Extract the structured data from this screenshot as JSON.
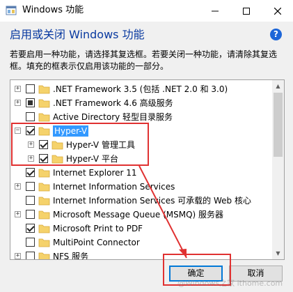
{
  "window": {
    "title": "Windows 功能",
    "minimize_glyph": "—",
    "maximize_glyph": "☐",
    "close_glyph": "✕"
  },
  "heading": "启用或关闭 Windows 功能",
  "help_glyph": "?",
  "description_line1": "若要启用一种功能，请选择其复选框。若要关闭一种功能，请清除其复选",
  "description_line2": "框。填充的框表示仅启用该功能的一部分。",
  "features": [
    {
      "label": ".NET Framework 3.5 (包括 .NET 2.0 和 3.0)",
      "state": "unchecked",
      "expander": "+"
    },
    {
      "label": ".NET Framework 4.6 高级服务",
      "state": "partial",
      "expander": "+"
    },
    {
      "label": "Active Directory 轻型目录服务",
      "state": "unchecked",
      "expander": ""
    },
    {
      "label": "Hyper-V",
      "state": "checked",
      "expander": "−",
      "selected": true
    },
    {
      "label": "Hyper-V 管理工具",
      "state": "checked",
      "expander": "+"
    },
    {
      "label": "Hyper-V 平台",
      "state": "checked",
      "expander": "+"
    },
    {
      "label": "Internet Explorer 11",
      "state": "checked",
      "expander": ""
    },
    {
      "label": "Internet Information Services",
      "state": "unchecked",
      "expander": "+"
    },
    {
      "label": "Internet Information Services 可承载的 Web 核心",
      "state": "unchecked",
      "expander": ""
    },
    {
      "label": "Microsoft Message Queue (MSMQ) 服务器",
      "state": "unchecked",
      "expander": "+"
    },
    {
      "label": "Microsoft Print to PDF",
      "state": "checked",
      "expander": ""
    },
    {
      "label": "MultiPoint Connector",
      "state": "unchecked",
      "expander": ""
    },
    {
      "label": "NFS 服务",
      "state": "unchecked",
      "expander": "+"
    }
  ],
  "buttons": {
    "ok": "确定",
    "cancel": "取消"
  },
  "colors": {
    "accent": "#0078d7",
    "selection": "#3399ff",
    "annotation": "#e03131",
    "folder": "#f5d26b"
  },
  "watermark": "@Windows之家 ithome.com"
}
